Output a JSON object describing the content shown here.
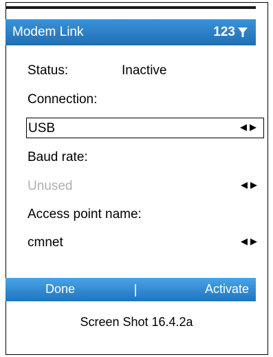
{
  "title": "Modem Link",
  "indicator": "123",
  "status": {
    "label": "Status:",
    "value": "Inactive"
  },
  "connection": {
    "label": "Connection:",
    "value": "USB"
  },
  "baud": {
    "label": "Baud rate:",
    "value": "Unused"
  },
  "apn": {
    "label": "Access point name:",
    "value": "cmnet"
  },
  "softkeys": {
    "left": "Done",
    "right": "Activate"
  },
  "caption": "Screen Shot 16.4.2a",
  "colors": {
    "title_bar": "#2a7fc8",
    "softkey_bar": "#2d86d2",
    "disabled_text": "#b0b0b0"
  }
}
